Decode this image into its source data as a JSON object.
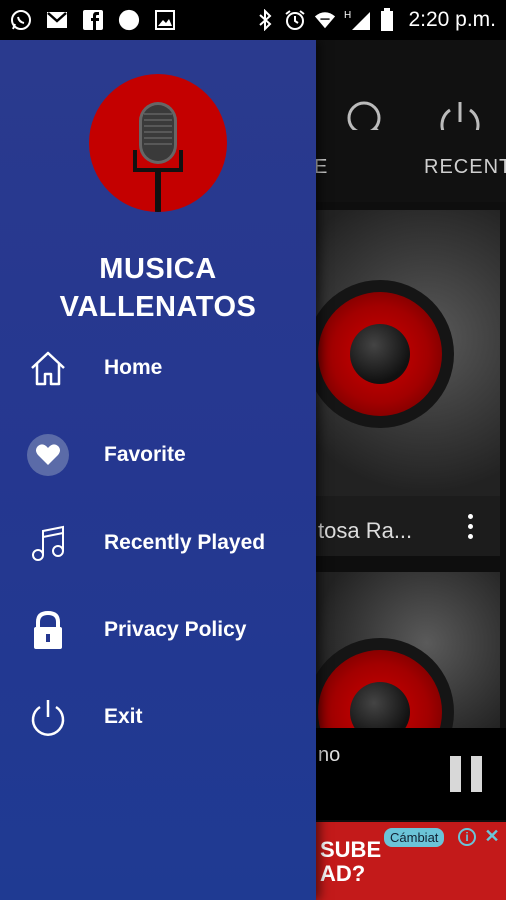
{
  "status_bar": {
    "time": "2:20 p.m.",
    "network": "H",
    "left_icons": [
      "whatsapp-icon",
      "gmail-icon",
      "facebook-icon",
      "circle-notification-icon",
      "image-icon"
    ],
    "right_icons": [
      "bluetooth-icon",
      "alarm-icon",
      "wifi-icon",
      "signal-icon",
      "battery-icon"
    ]
  },
  "drawer": {
    "app_name_line1": "MUSICA",
    "app_name_line2": "VALLENATOS",
    "logo_icon": "microphone-icon",
    "menu": [
      {
        "label": "Home",
        "icon": "home-icon"
      },
      {
        "label": "Favorite",
        "icon": "heart-icon"
      },
      {
        "label": "Recently Played",
        "icon": "music-note-icon"
      },
      {
        "label": "Privacy Policy",
        "icon": "lock-icon"
      },
      {
        "label": "Exit",
        "icon": "power-icon"
      }
    ]
  },
  "background_app": {
    "tabs": [
      "E",
      "RECENT"
    ],
    "cards": [
      {
        "title": "tosa Ra..."
      }
    ],
    "player": {
      "title": "no"
    },
    "ad": {
      "text": "SUBE\nAD?",
      "badge": "Cámbiat"
    }
  },
  "colors": {
    "drawer_bg": "#253790",
    "logo_red": "#c40000",
    "ad_red": "#c31a1a"
  }
}
